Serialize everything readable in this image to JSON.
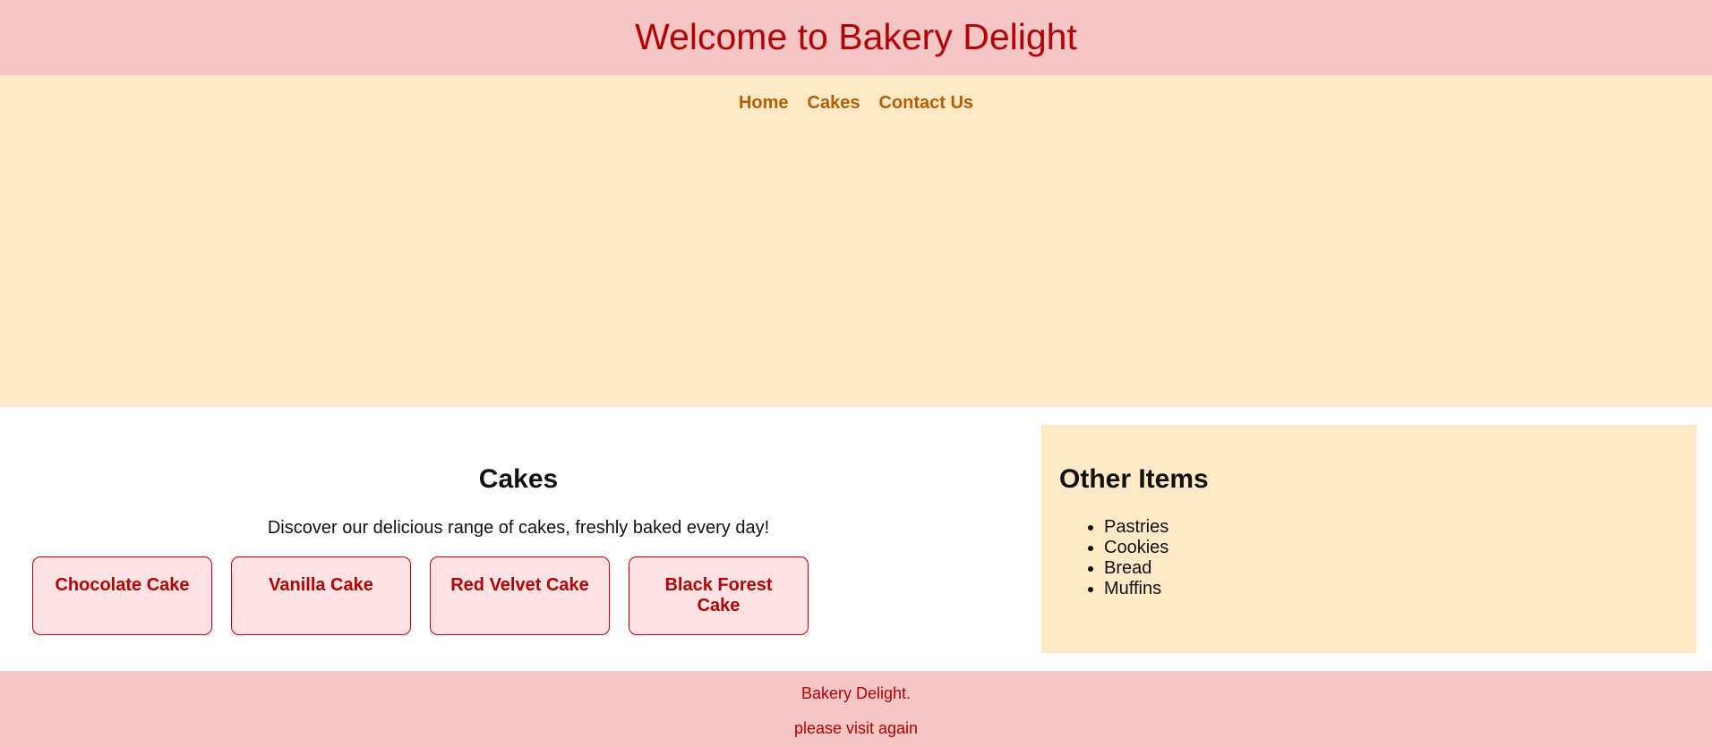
{
  "header": {
    "title": "Welcome to Bakery Delight"
  },
  "nav": {
    "items": [
      {
        "label": "Home"
      },
      {
        "label": "Cakes"
      },
      {
        "label": "Contact Us"
      }
    ]
  },
  "cakes": {
    "heading": "Cakes",
    "description": "Discover our delicious range of cakes, freshly baked every day!",
    "items": [
      {
        "name": "Chocolate Cake"
      },
      {
        "name": "Vanilla Cake"
      },
      {
        "name": "Red Velvet Cake"
      },
      {
        "name": "Black Forest Cake"
      }
    ]
  },
  "other_items": {
    "heading": "Other Items",
    "items": [
      "Pastries",
      "Cookies",
      "Bread",
      "Muffins"
    ]
  },
  "footer": {
    "line1": "Bakery Delight.",
    "line2": "please visit again"
  },
  "colors": {
    "header_bg": "#f6c6c7",
    "nav_bg": "#ffe9c7",
    "title_color": "#b30000",
    "nav_link_color": "#b35f00",
    "card_bg": "#ffe3e4",
    "card_border": "#c40000"
  }
}
